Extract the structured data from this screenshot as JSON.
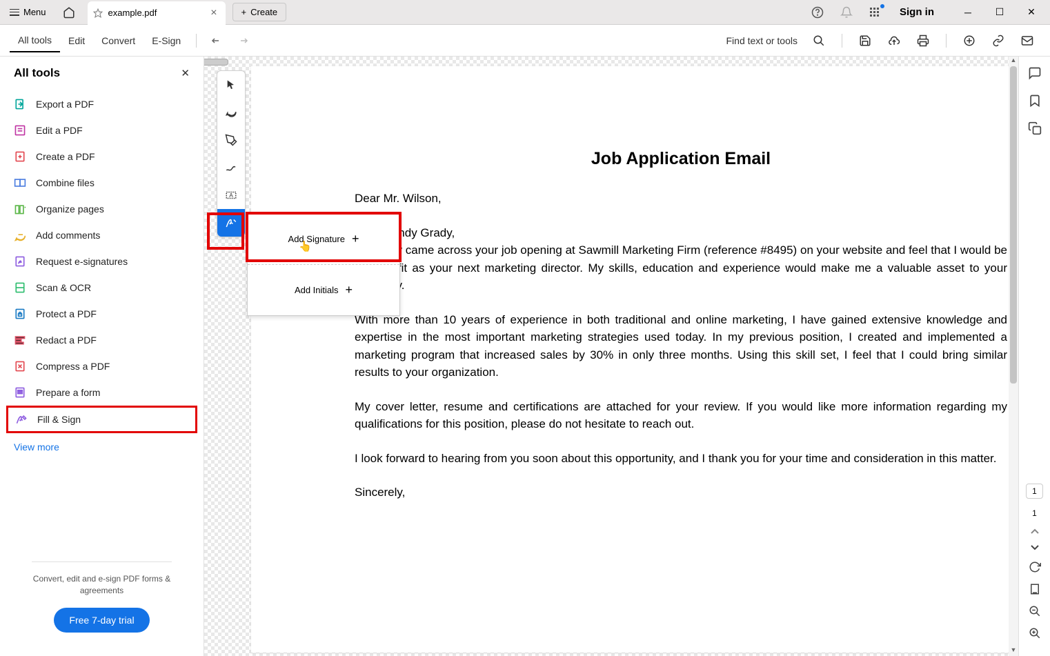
{
  "titlebar": {
    "menu": "Menu",
    "tab_name": "example.pdf",
    "create": "Create",
    "signin": "Sign in"
  },
  "toolbar": {
    "items": [
      "All tools",
      "Edit",
      "Convert",
      "E-Sign"
    ],
    "find_text": "Find text or tools"
  },
  "sidebar": {
    "title": "All tools",
    "tools": [
      {
        "label": "Export a PDF",
        "color": "#00a59a",
        "icon": "export"
      },
      {
        "label": "Edit a PDF",
        "color": "#c034a3",
        "icon": "edit"
      },
      {
        "label": "Create a PDF",
        "color": "#e34850",
        "icon": "create"
      },
      {
        "label": "Combine files",
        "color": "#4b7de0",
        "icon": "combine"
      },
      {
        "label": "Organize pages",
        "color": "#5cb749",
        "icon": "organize"
      },
      {
        "label": "Add comments",
        "color": "#e8b22f",
        "icon": "comment"
      },
      {
        "label": "Request e-signatures",
        "color": "#8e5de0",
        "icon": "request"
      },
      {
        "label": "Scan & OCR",
        "color": "#2dbd6e",
        "icon": "scan"
      },
      {
        "label": "Protect a PDF",
        "color": "#1b7bc4",
        "icon": "protect"
      },
      {
        "label": "Redact a PDF",
        "color": "#d84d62",
        "icon": "redact"
      },
      {
        "label": "Compress a PDF",
        "color": "#e34850",
        "icon": "compress"
      },
      {
        "label": "Prepare a form",
        "color": "#8e5de0",
        "icon": "form"
      },
      {
        "label": "Fill & Sign",
        "color": "#8e5de0",
        "icon": "fillsign"
      }
    ],
    "view_more": "View more",
    "footer_text": "Convert, edit and e-sign PDF forms & agreements",
    "trial_btn": "Free 7-day trial"
  },
  "sign_menu": {
    "add_signature": "Add Signature",
    "add_initials": "Add Initials"
  },
  "document": {
    "title": "Job Application Email",
    "line1": "Dear Mr. Wilson,",
    "line2": "Dear Randy Grady,",
    "para1": "I recently came across your job opening at Sawmill Marketing Firm (reference #8495) on your website and feel that I would be a great fit as your next marketing director. My skills, education and experience would make me a valuable asset to your company.",
    "para2": "With more than 10 years of experience in both traditional and online marketing, I have gained extensive knowledge and expertise in the most important marketing strategies used today. In my previous position, I created and implemented a marketing program that increased sales by 30% in only three months. Using this skill set, I feel that I could bring similar results to your organization.",
    "para3": "My cover letter, resume and certifications are attached for your review. If you would like more information regarding my qualifications for this position, please do not hesitate to reach out.",
    "para4": "I look forward to hearing from you soon about this opportunity, and I thank you for your time and consideration in this matter.",
    "closing": "Sincerely,"
  },
  "page_info": {
    "current": "1",
    "total": "1"
  }
}
